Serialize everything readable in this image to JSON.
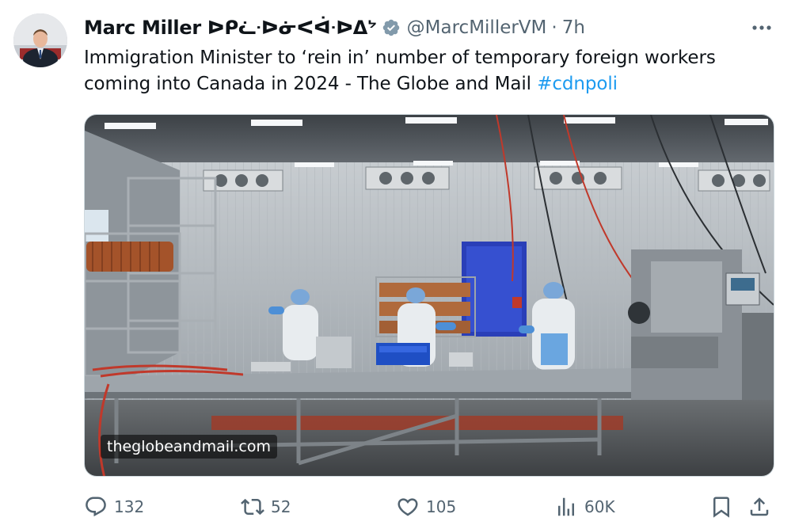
{
  "author": {
    "display_name": "Marc Miller ᐅᑭᓛᐧᐅᓃᐸᐋᐧᐅᐃᔾ",
    "handle": "@MarcMillerVM",
    "separator": "·",
    "time": "7h",
    "verified_icon": "verified-badge-icon",
    "avatar_icon": "avatar"
  },
  "tweet": {
    "text": "Immigration Minister to ‘rein in’ number of temporary foreign workers coming into Canada in 2024 - The Globe and Mail ",
    "hashtag": "#cdnpoli"
  },
  "media": {
    "link_domain": "theglobeandmail.com"
  },
  "actions": {
    "reply_count": "132",
    "retweet_count": "52",
    "like_count": "105",
    "views_count": "60K"
  },
  "colors": {
    "accent": "#1d9bf0",
    "secondary_text": "#536471",
    "primary_text": "#0f1419"
  }
}
